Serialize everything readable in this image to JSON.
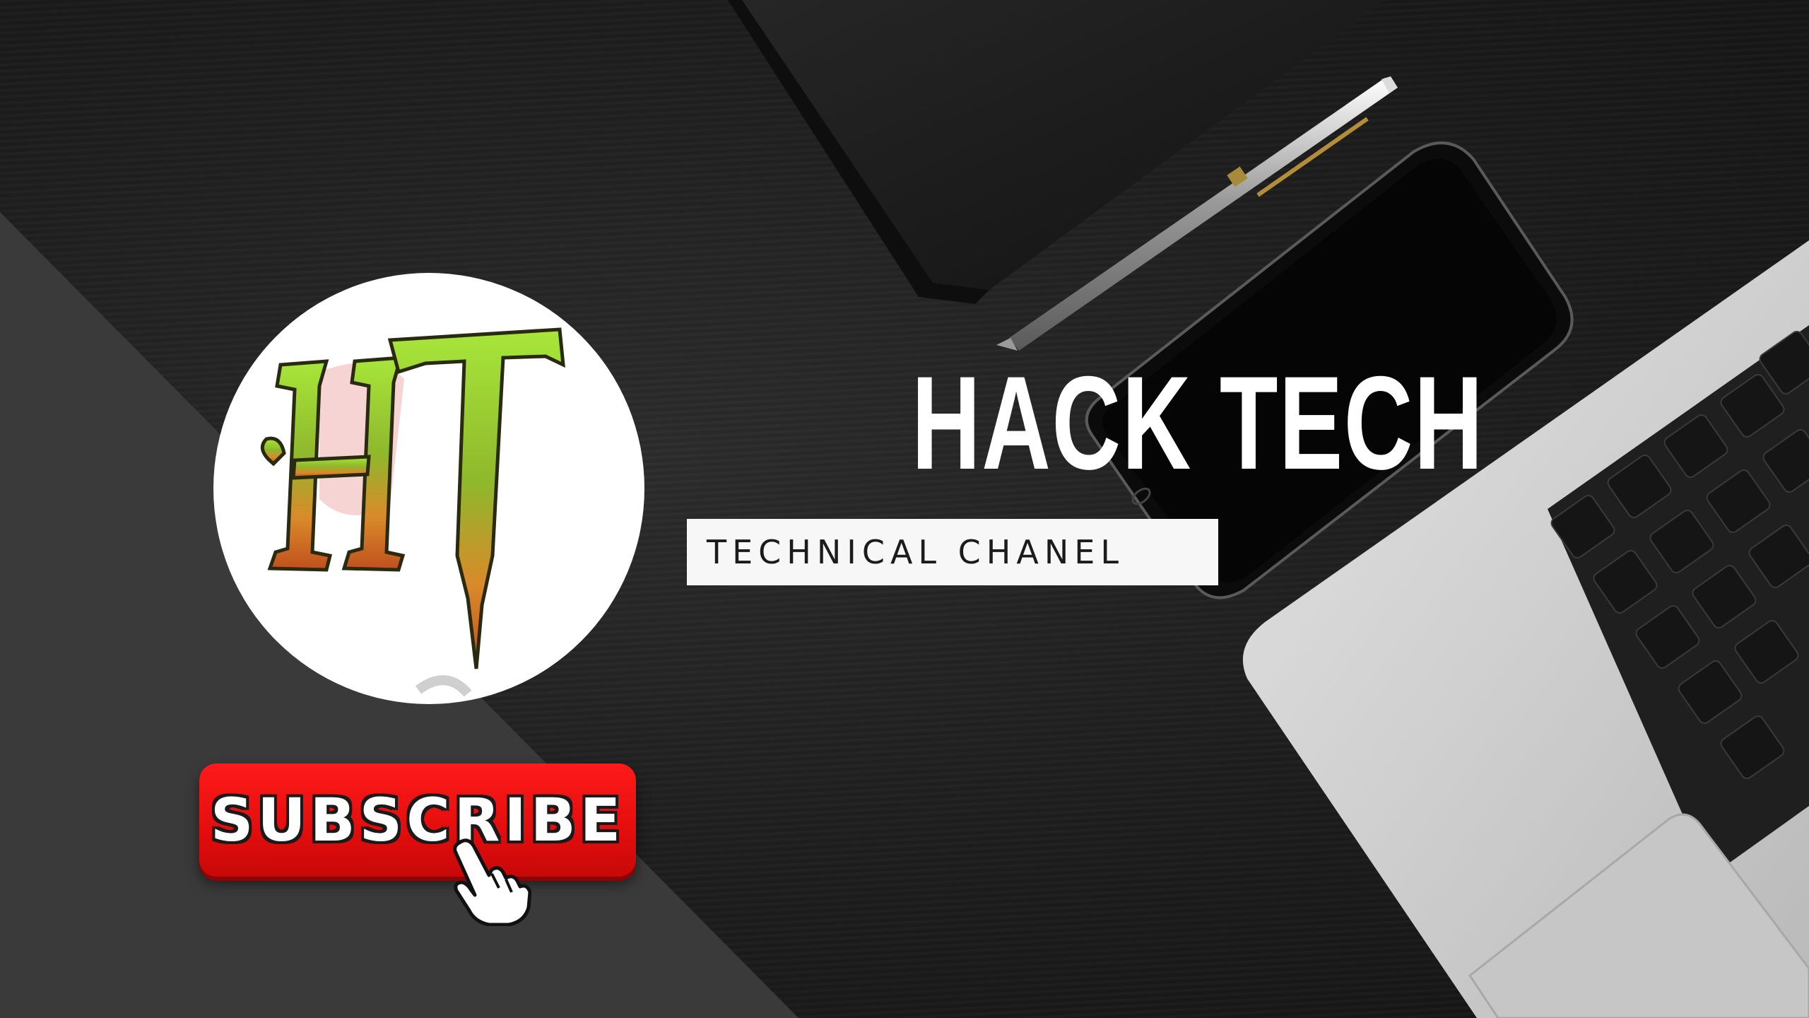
{
  "channel": {
    "logo_text": "HT",
    "title": "HACK TECH",
    "tagline": "TECHNICAL CHANEL"
  },
  "cta": {
    "subscribe_label": "SUBSCRIBE"
  },
  "icons": {
    "logo": "ht-monogram-icon",
    "cursor": "hand-pointer-icon"
  },
  "colors": {
    "subscribe_red": "#e30d0d",
    "tag_background": "#f7f7f7",
    "title_color": "#ffffff",
    "panel_gray": "#3a3a3a"
  }
}
